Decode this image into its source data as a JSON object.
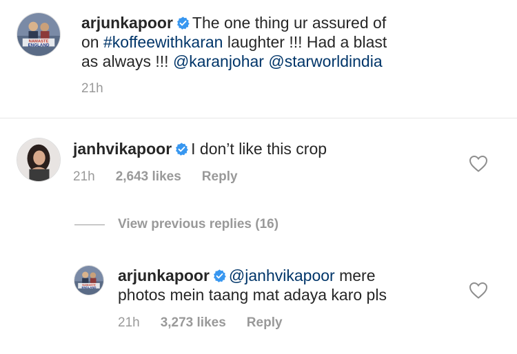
{
  "post": {
    "username": "arjunkapoor",
    "caption_line1_pre": "The one thing ur assured of",
    "caption_line2_pre": "on ",
    "caption_hashtag": "#koffeewithkaran",
    "caption_line2_post": " laughter !!! Had a blast",
    "caption_line3_pre": "as always !!! ",
    "caption_mention1": "@karanjohar",
    "caption_mention2": "@starworldindia",
    "time": "21h",
    "avatar_text_top": "NAMASTE",
    "avatar_text_bottom": "ENGLAND"
  },
  "comment": {
    "username": "janhvikapoor",
    "text": "I don’t like this crop",
    "time": "21h",
    "likes": "2,643 likes",
    "reply_label": "Reply",
    "heart_icon": "heart-outline-icon"
  },
  "view_previous": {
    "label": "View previous replies (16)"
  },
  "reply": {
    "username": "arjunkapoor",
    "mention": "@janhvikapoor",
    "text_line1_post": " mere",
    "text_line2": "photos mein taang mat adaya karo pls",
    "time": "21h",
    "likes": "3,273 likes",
    "reply_label": "Reply",
    "avatar_text_top": "NAMASTE",
    "avatar_text_bottom": "ENGLAND"
  },
  "colors": {
    "verified_blue": "#3897f0",
    "link": "#003569",
    "muted": "#999999",
    "text": "#262626"
  }
}
